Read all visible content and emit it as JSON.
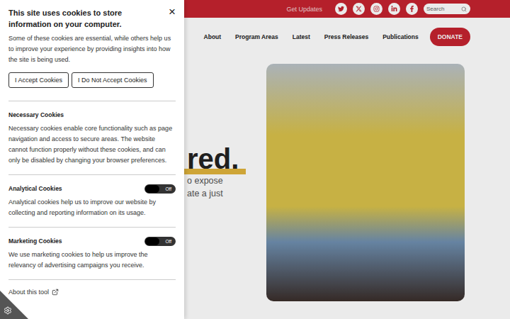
{
  "site": {
    "top_bar": {
      "link": "Get Updates",
      "search_placeholder": "Search"
    },
    "nav": [
      "About",
      "Program Areas",
      "Latest",
      "Press Releases",
      "Publications"
    ],
    "donate": "DONATE",
    "hero": {
      "heading": "red.",
      "lines": [
        "o expose",
        "ate a just"
      ]
    }
  },
  "cookie_panel": {
    "close": "×",
    "title": "This site uses cookies to store information on your computer.",
    "intro": "Some of these cookies are essential, while others help us to improve your experience by providing insights into how the site is being used.",
    "buttons": [
      "I Accept Cookies",
      "I Do Not Accept Cookies"
    ],
    "sections": [
      {
        "heading": "Necessary Cookies",
        "kind": "fixed",
        "description": "Necessary cookies enable core functionality such as page navigation and access to secure areas. The website cannot function properly without these cookies, and can only be disabled by changing your browser preferences."
      },
      {
        "heading": "Analytical Cookies",
        "kind": "toggle",
        "on": false,
        "toggle_label": "Off",
        "description": "Analytical cookies help us to improve our website by collecting and reporting information on its usage."
      },
      {
        "heading": "Marketing Cookies",
        "kind": "toggle",
        "on": false,
        "toggle_label": "Off",
        "description": "We use marketing cookies to help us improve the relevancy of advertising campaigns you receive."
      }
    ],
    "about_link": "About this tool"
  }
}
